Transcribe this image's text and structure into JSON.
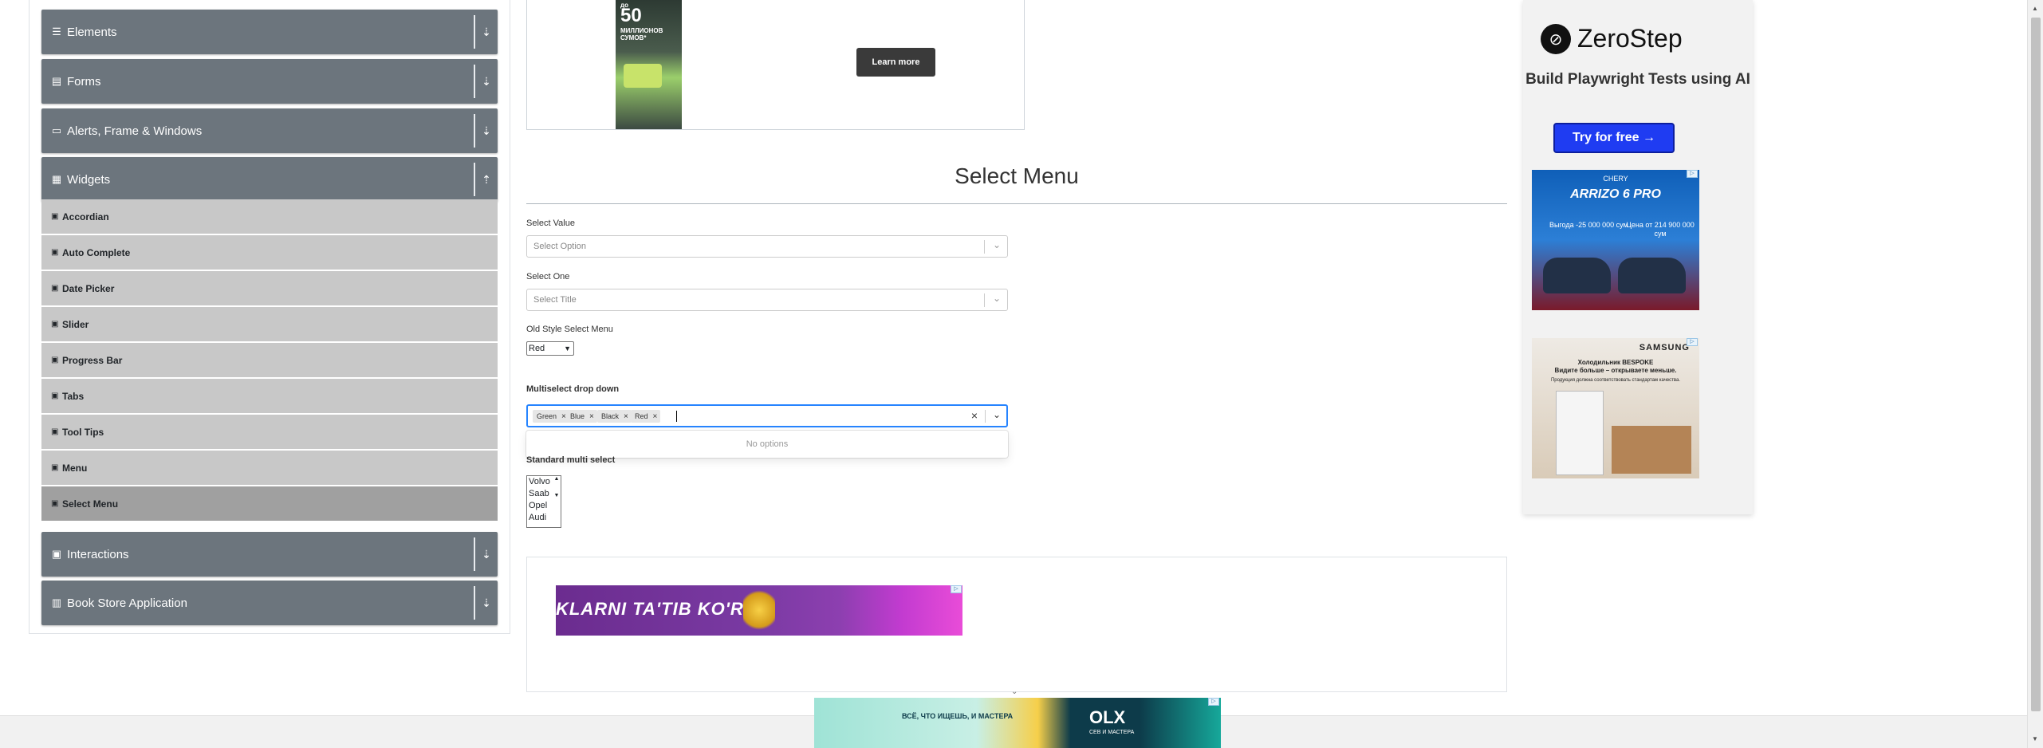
{
  "sidebar": {
    "groups_top": [
      {
        "label": "Elements",
        "icon": "list-icon"
      },
      {
        "label": "Forms",
        "icon": "form-icon"
      },
      {
        "label": "Alerts, Frame & Windows",
        "icon": "window-icon"
      },
      {
        "label": "Widgets",
        "icon": "grid-icon"
      }
    ],
    "items": [
      {
        "label": "Accordian"
      },
      {
        "label": "Auto Complete"
      },
      {
        "label": "Date Picker"
      },
      {
        "label": "Slider"
      },
      {
        "label": "Progress Bar"
      },
      {
        "label": "Tabs"
      },
      {
        "label": "Tool Tips"
      },
      {
        "label": "Menu"
      },
      {
        "label": "Select Menu"
      }
    ],
    "groups_bottom": [
      {
        "label": "Interactions",
        "icon": "interactions-icon"
      },
      {
        "label": "Book Store Application",
        "icon": "book-icon"
      }
    ]
  },
  "ads": {
    "top_phone": {
      "line1": "до",
      "line2": "50",
      "line3": "МИЛЛИОНОВ СУМОВ*"
    },
    "learn_more": "Learn more",
    "banner": "KLARNI TA'TIB KO'R",
    "zerostep_name": "ZeroStep",
    "zerostep_tag": "Build Playwright Tests using AI",
    "zerostep_btn": "Try for free →",
    "car_brand": "CHERY",
    "car_model": "ARRIZO 6 PRO",
    "car_price_1": "Выгода -25 000 000 сум",
    "car_price_2": "Цена от 214 900 000 сум",
    "fridge_brand": "SAMSUNG",
    "fridge_l1": "Холодильник BESPOKE",
    "fridge_l2": "Видите больше – открываете меньше.",
    "fridge_l3": "Продукция должна соответствовать стандартам качества.",
    "bottom_ru": "ВСЁ, ЧТО ИЩЕШЬ, И МАСТЕРА",
    "bottom_olx": "OLX",
    "bottom_olx_sub": "СЕВ И МАСТЕРА"
  },
  "main": {
    "title": "Select Menu",
    "select_value_label": "Select Value",
    "select_value_placeholder": "Select Option",
    "select_one_label": "Select One",
    "select_one_placeholder": "Select Title",
    "old_style_label": "Old Style Select Menu",
    "old_style_value": "Red",
    "multiselect_label": "Multiselect drop down",
    "multiselect_chips": [
      "Green",
      "Blue",
      "Black",
      "Red"
    ],
    "no_options": "No options",
    "standard_label": "Standard multi select",
    "standard_options": [
      "Volvo",
      "Saab",
      "Opel",
      "Audi"
    ]
  },
  "colors": {
    "group_header": "#6c757d",
    "menu_item": "#c8c8c8",
    "menu_item_active": "#a0a0a0",
    "focus_border": "#2684ff",
    "cta_blue": "#1f3cf2"
  }
}
